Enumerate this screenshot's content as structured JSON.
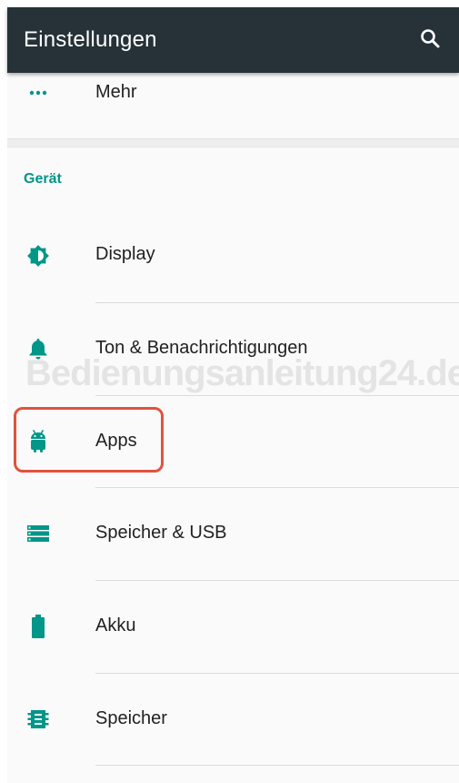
{
  "appbar": {
    "title": "Einstellungen",
    "search_icon": "search-icon",
    "background": "#263238"
  },
  "accent_color": "#009688",
  "highlight_color": "#e0533f",
  "top_item": {
    "label": "Mehr",
    "icon": "more-dots-icon"
  },
  "section": {
    "header": "Gerät"
  },
  "items": [
    {
      "label": "Display",
      "icon": "brightness-icon"
    },
    {
      "label": "Ton & Benachrichtigungen",
      "icon": "bell-icon"
    },
    {
      "label": "Apps",
      "icon": "android-icon"
    },
    {
      "label": "Speicher & USB",
      "icon": "storage-icon"
    },
    {
      "label": "Akku",
      "icon": "battery-icon"
    },
    {
      "label": "Speicher",
      "icon": "memory-chip-icon"
    }
  ],
  "watermark": "Bedienungsanleitung24.de"
}
